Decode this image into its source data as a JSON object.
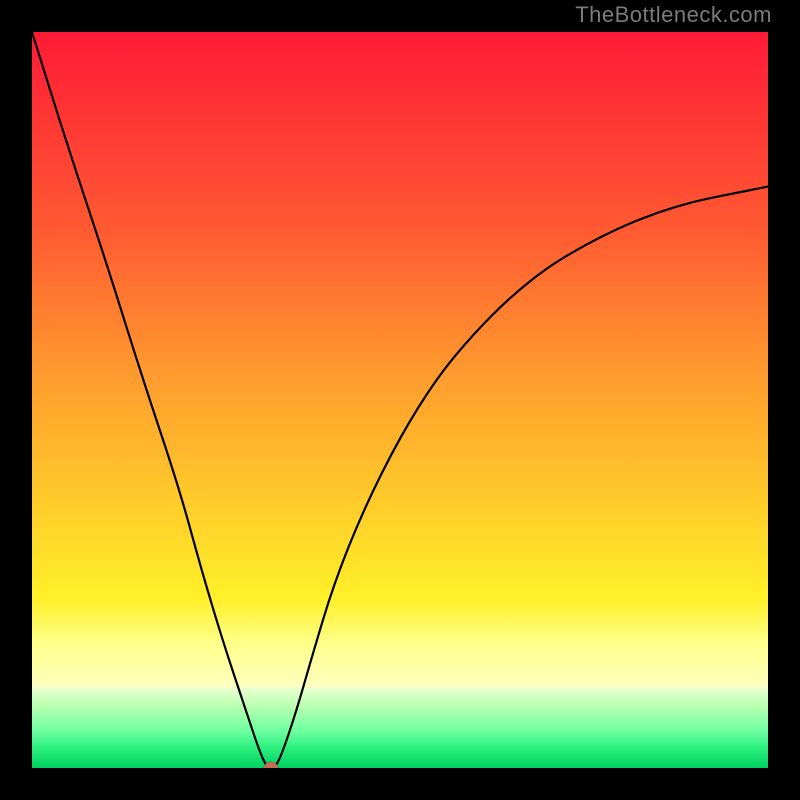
{
  "watermark": "TheBottleneck.com",
  "chart_data": {
    "type": "line",
    "title": "",
    "xlabel": "",
    "ylabel": "",
    "xlim": [
      0,
      100
    ],
    "ylim": [
      0,
      100
    ],
    "grid": false,
    "background_gradient": {
      "top": "#ff1a36",
      "mid": "#fff028",
      "bottom": "#00d060"
    },
    "series": [
      {
        "name": "bottleneck-curve",
        "x": [
          0,
          5,
          10,
          15,
          20,
          23,
          26,
          29,
          31,
          32,
          33,
          34,
          36,
          38,
          41,
          45,
          50,
          55,
          60,
          65,
          70,
          75,
          80,
          85,
          90,
          95,
          100
        ],
        "values": [
          100,
          84,
          69,
          53,
          38,
          27,
          17,
          8,
          2,
          0,
          0,
          2,
          8,
          15,
          25,
          35,
          45,
          53,
          59,
          64,
          68,
          71,
          73.5,
          75.5,
          77,
          78,
          79
        ]
      }
    ],
    "annotations": [
      {
        "name": "min-marker",
        "x": 32.5,
        "y": 0,
        "shape": "ellipse",
        "color": "#c96a58"
      }
    ]
  }
}
